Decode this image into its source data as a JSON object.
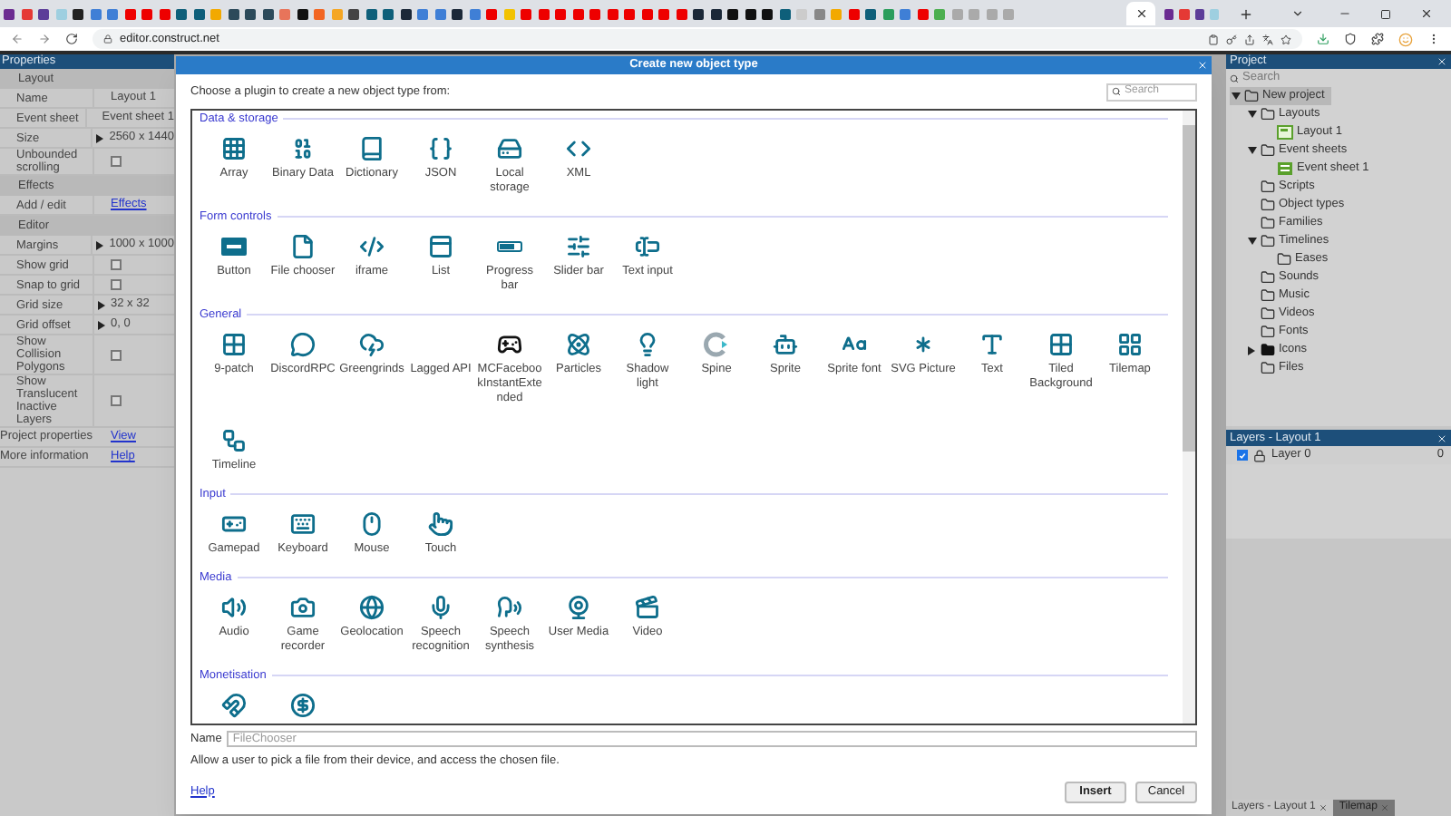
{
  "browser": {
    "url": "editor.construct.net"
  },
  "properties": {
    "title": "Properties",
    "rows": [
      {
        "kind": "header",
        "label": "Layout"
      },
      {
        "kind": "text",
        "label": "Name",
        "value": "Layout 1"
      },
      {
        "kind": "text",
        "label": "Event sheet",
        "value": "Event sheet 1"
      },
      {
        "kind": "expand",
        "label": "Size",
        "value": "2560 x 1440"
      },
      {
        "kind": "check",
        "label": "Unbounded scrolling",
        "checked": false
      },
      {
        "kind": "header",
        "label": "Effects"
      },
      {
        "kind": "link",
        "label": "Add / edit",
        "value": "Effects"
      },
      {
        "kind": "header",
        "label": "Editor"
      },
      {
        "kind": "expand",
        "label": "Margins",
        "value": "1000 x 1000"
      },
      {
        "kind": "check",
        "label": "Show grid",
        "checked": false
      },
      {
        "kind": "check",
        "label": "Snap to grid",
        "checked": false
      },
      {
        "kind": "expand",
        "label": "Grid size",
        "value": "32 x 32"
      },
      {
        "kind": "expand",
        "label": "Grid offset",
        "value": "0, 0"
      },
      {
        "kind": "check",
        "label": "Show Collision Polygons",
        "checked": false
      },
      {
        "kind": "check",
        "label": "Show Translucent Inactive Layers",
        "checked": false
      },
      {
        "kind": "root-link",
        "label": "Project properties",
        "value": "View"
      },
      {
        "kind": "root-link",
        "label": "More information",
        "value": "Help"
      }
    ]
  },
  "dialog": {
    "title": "Create new object type",
    "prompt": "Choose a plugin to create a new object type from:",
    "search_placeholder": "Search",
    "sections": [
      {
        "title": "Data & storage",
        "items": [
          {
            "kind": "tile",
            "label": "Array"
          },
          {
            "kind": "tile",
            "label": "Binary Data"
          },
          {
            "kind": "tile",
            "label": "Dictionary"
          },
          {
            "kind": "tile",
            "label": "JSON"
          },
          {
            "kind": "tile",
            "label": "Local storage"
          },
          {
            "kind": "tile",
            "label": "XML"
          }
        ]
      },
      {
        "title": "Form controls",
        "items": [
          {
            "kind": "tile",
            "label": "Button"
          },
          {
            "kind": "tile",
            "label": "File chooser"
          },
          {
            "kind": "tile",
            "label": "iframe"
          },
          {
            "kind": "tile",
            "label": "List"
          },
          {
            "kind": "tile",
            "label": "Progress bar"
          },
          {
            "kind": "tile",
            "label": "Slider bar"
          },
          {
            "kind": "tile",
            "label": "Text input"
          }
        ]
      },
      {
        "title": "General",
        "items": [
          {
            "kind": "tile",
            "label": "9-patch"
          },
          {
            "kind": "tile",
            "label": "DiscordRPC"
          },
          {
            "kind": "tile",
            "label": "Greengrinds"
          },
          {
            "kind": "tile",
            "label": "Lagged API"
          },
          {
            "kind": "tile",
            "label": "MCFacebookInstantExtended"
          },
          {
            "kind": "tile",
            "label": "Particles"
          },
          {
            "kind": "tile",
            "label": "Shadow light"
          },
          {
            "kind": "tile",
            "label": "Spine"
          },
          {
            "kind": "tile",
            "label": "Sprite"
          },
          {
            "kind": "tile",
            "label": "Sprite font"
          },
          {
            "kind": "tile",
            "label": "SVG Picture"
          },
          {
            "kind": "tile",
            "label": "Text"
          },
          {
            "kind": "tile",
            "label": "Tiled Background"
          },
          {
            "kind": "tile",
            "label": "Tilemap"
          },
          {
            "kind": "tile",
            "label": "Timeline"
          }
        ]
      },
      {
        "title": "Input",
        "items": [
          {
            "kind": "tile",
            "label": "Gamepad"
          },
          {
            "kind": "tile",
            "label": "Keyboard"
          },
          {
            "kind": "tile",
            "label": "Mouse"
          },
          {
            "kind": "tile",
            "label": "Touch"
          }
        ]
      },
      {
        "title": "Media",
        "items": [
          {
            "kind": "tile",
            "label": "Audio"
          },
          {
            "kind": "tile",
            "label": "Game recorder"
          },
          {
            "kind": "tile",
            "label": "Geolocation"
          },
          {
            "kind": "tile",
            "label": "Speech recognition"
          },
          {
            "kind": "tile",
            "label": "Speech synthesis"
          },
          {
            "kind": "tile",
            "label": "User Media"
          },
          {
            "kind": "tile",
            "label": "Video"
          }
        ]
      },
      {
        "title": "Monetisation",
        "items": [
          {
            "kind": "icon"
          },
          {
            "kind": "icon"
          }
        ]
      }
    ],
    "name_label": "Name",
    "name_placeholder": "FileChooser",
    "description": "Allow a user to pick a file from their device, and access the chosen file.",
    "help": "Help",
    "buttons": [
      {
        "label": "Insert",
        "kind": "primary"
      },
      {
        "label": "Cancel",
        "kind": "secondary"
      }
    ]
  },
  "project": {
    "title": "Project",
    "search_placeholder": "Search",
    "tree": [
      {
        "label": "New project",
        "kind": "folder",
        "selected": true,
        "expanded": true,
        "children": [
          {
            "label": "Layouts",
            "kind": "folder",
            "selected": false,
            "expanded": true,
            "children": [
              {
                "label": "Layout 1",
                "kind": "layout",
                "selected": false
              }
            ]
          },
          {
            "label": "Event sheets",
            "kind": "folder",
            "selected": false,
            "expanded": true,
            "children": [
              {
                "label": "Event sheet 1",
                "kind": "eventsheet",
                "selected": false
              }
            ]
          },
          {
            "label": "Scripts",
            "kind": "folder",
            "selected": false
          },
          {
            "label": "Object types",
            "kind": "folder",
            "selected": false
          },
          {
            "label": "Families",
            "kind": "folder",
            "selected": false
          },
          {
            "label": "Timelines",
            "kind": "folder",
            "selected": false,
            "expanded": true,
            "children": [
              {
                "label": "Eases",
                "kind": "folder",
                "selected": false
              }
            ]
          },
          {
            "label": "Sounds",
            "kind": "folder",
            "selected": false
          },
          {
            "label": "Music",
            "kind": "folder",
            "selected": false
          },
          {
            "label": "Videos",
            "kind": "folder",
            "selected": false
          },
          {
            "label": "Fonts",
            "kind": "folder",
            "selected": false
          },
          {
            "label": "Icons",
            "kind": "folder-filled",
            "selected": false,
            "expanded": false
          },
          {
            "label": "Files",
            "kind": "folder",
            "selected": false
          }
        ]
      }
    ]
  },
  "layers": {
    "title": "Layers - Layout 1",
    "rows": [
      {
        "name": "Layer 0",
        "visible": true,
        "count": "0"
      }
    ]
  },
  "bottom_tabs": [
    {
      "label": "Layers - Layout 1",
      "selected": true
    },
    {
      "label": "Tilemap",
      "selected": false
    }
  ]
}
